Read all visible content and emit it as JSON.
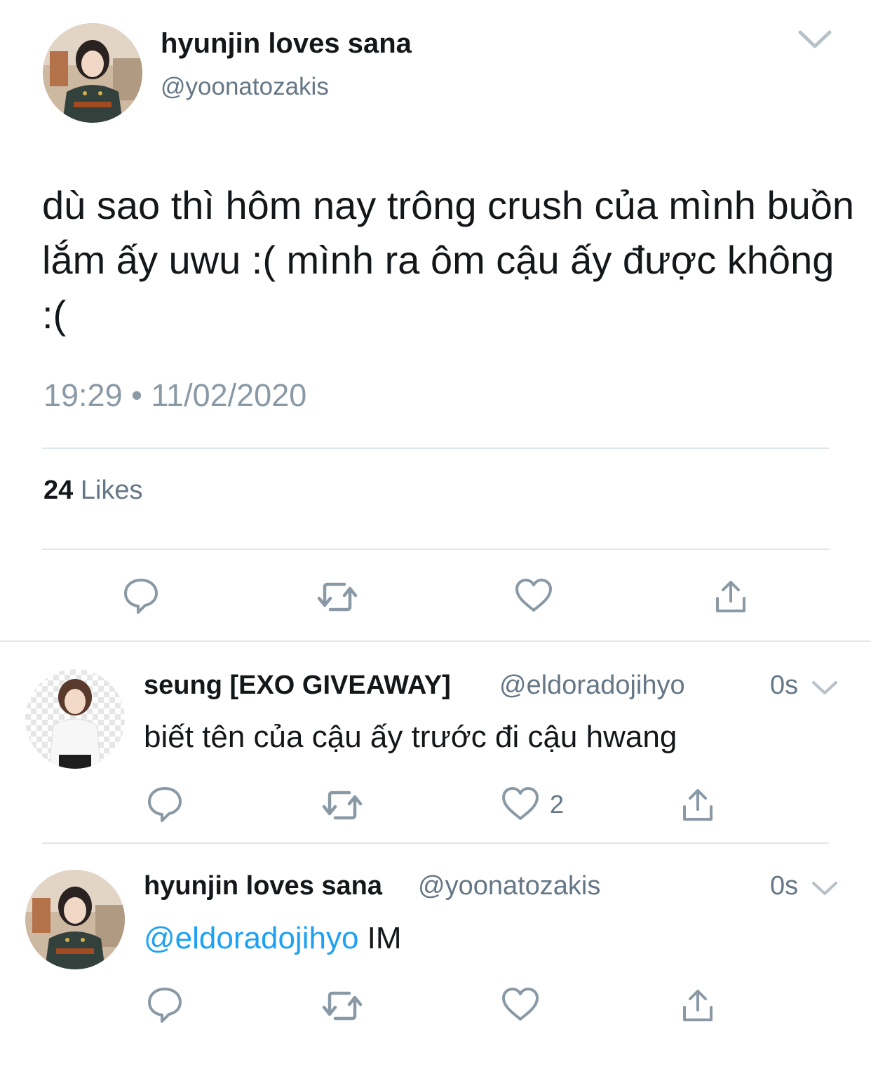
{
  "tweet": {
    "author_name": "hyunjin loves sana",
    "author_handle": "@yoonatozakis",
    "text": "dù sao thì hôm nay trông crush của mình buồn lắm ấy uwu :( mình ra ôm cậu ấy được không :(",
    "timestamp": "19:29 • 11/02/2020",
    "likes_count": "24",
    "likes_label": "Likes",
    "actions": [
      "reply-icon",
      "retweet-icon",
      "like-icon",
      "share-icon"
    ]
  },
  "replies": [
    {
      "author_name": "seung [EXO GIVEAWAY]",
      "author_handle": "@eldoradojihyo",
      "time": "0s",
      "text": "biết tên của cậu ấy trước đi cậu hwang",
      "like_count": "2"
    },
    {
      "author_name": "hyunjin loves sana",
      "author_handle": "@yoonatozakis",
      "time": "0s",
      "mention": "@eldoradojihyo",
      "text": " IM",
      "like_count": ""
    }
  ],
  "colors": {
    "text": "#14171a",
    "secondary": "#657786",
    "icon": "#8a99a6",
    "link": "#1da1f2",
    "divider": "#e1e8ed"
  }
}
